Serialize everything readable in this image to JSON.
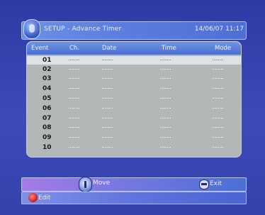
{
  "header": {
    "title": "SETUP - Advance Timer",
    "datetime": "14/06/07 11:17",
    "icon": "remote-icon"
  },
  "table": {
    "columns": [
      "Event",
      "Ch.",
      "Date",
      "Time",
      "Mode"
    ],
    "placeholder": "-----",
    "selected_index": 0,
    "rows": [
      "01",
      "02",
      "03",
      "04",
      "05",
      "06",
      "07",
      "08",
      "09",
      "10"
    ]
  },
  "footer": {
    "move": {
      "icon": "navigation-icon",
      "label": "Move"
    },
    "exit": {
      "icon": "exit-icon",
      "label": "Exit"
    },
    "edit": {
      "icon": "red-button-icon",
      "label": "Edit"
    }
  },
  "colors": {
    "background": "#3a44b4",
    "header_bar": "#5d7fe0",
    "panel": "#b2b7b8",
    "selected_row": "#dfe2e4",
    "edit_button": "#c71818"
  }
}
